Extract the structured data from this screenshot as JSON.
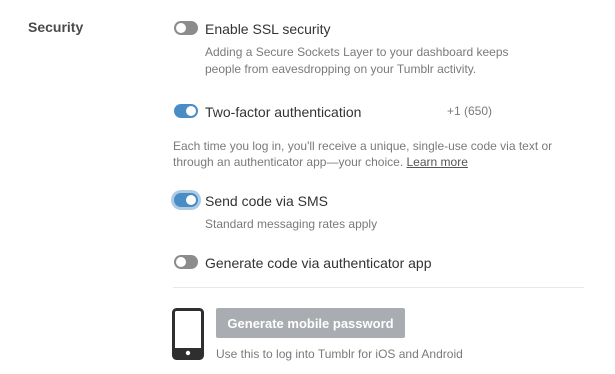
{
  "section": {
    "title": "Security"
  },
  "ssl": {
    "label": "Enable SSL security",
    "enabled": false,
    "description_line1": "Adding a Secure Sockets Layer to your dashboard keeps",
    "description_line2": "people from eavesdropping on your Tumblr activity."
  },
  "two_factor": {
    "label": "Two-factor authentication",
    "enabled": true,
    "phone": "+1 (650)",
    "description_line1": "Each time you log in, you'll receive a unique, single-use code via text or",
    "description_line2": "through an authenticator app—your choice.",
    "learn_more": "Learn more"
  },
  "sms": {
    "label": "Send code via SMS",
    "enabled": true,
    "description": "Standard messaging rates apply"
  },
  "authenticator": {
    "label": "Generate code via authenticator app",
    "enabled": false
  },
  "mobile_password": {
    "button_label": "Generate mobile password",
    "description": "Use this to log into Tumblr for iOS and Android"
  },
  "colors": {
    "toggle_on": "#4a8cc4",
    "toggle_off": "#8c8c8c",
    "button_bg": "#a9acb0"
  },
  "icons": [
    "mobile-phone-icon"
  ]
}
